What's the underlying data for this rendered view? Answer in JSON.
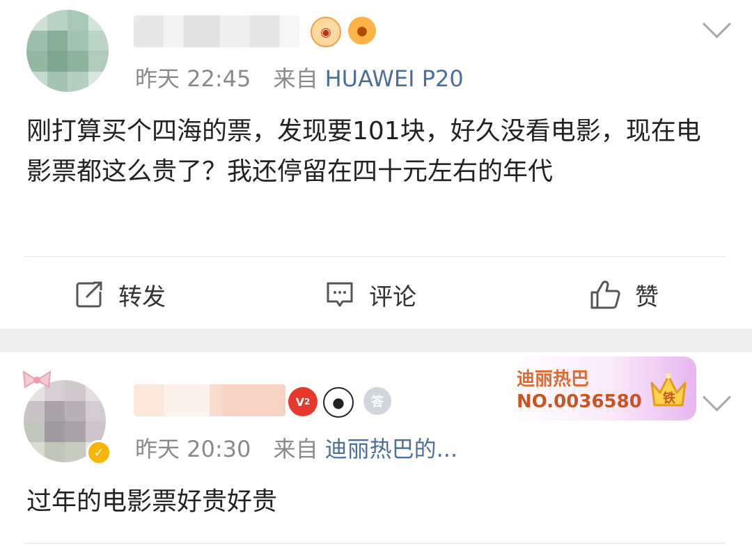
{
  "post1": {
    "time": "昨天 22:45",
    "source_prefix": "来自",
    "source": "HUAWEI P20",
    "content": "刚打算买个四海的票，发现要101块，好久没看电影，现在电影票都这么贵了？我还停留在四十元左右的年代",
    "actions": {
      "repost": "转发",
      "comment": "评论",
      "like": "赞"
    },
    "badges": [
      "tiger-badge-icon",
      "fish-badge-icon"
    ]
  },
  "post2": {
    "time": "昨天 20:30",
    "source_prefix": "来自",
    "source": "迪丽热巴的...",
    "content": "过年的电影票好贵好贵",
    "vip_level": "2",
    "answer_badge": "答",
    "fan_card": {
      "name": "迪丽热巴",
      "number": "NO.0036580",
      "tier": "铁"
    }
  },
  "colors": {
    "link_blue": "#4a6f9d",
    "meta_gray": "#8a8a8a",
    "fan_orange": "#e06a2e"
  }
}
